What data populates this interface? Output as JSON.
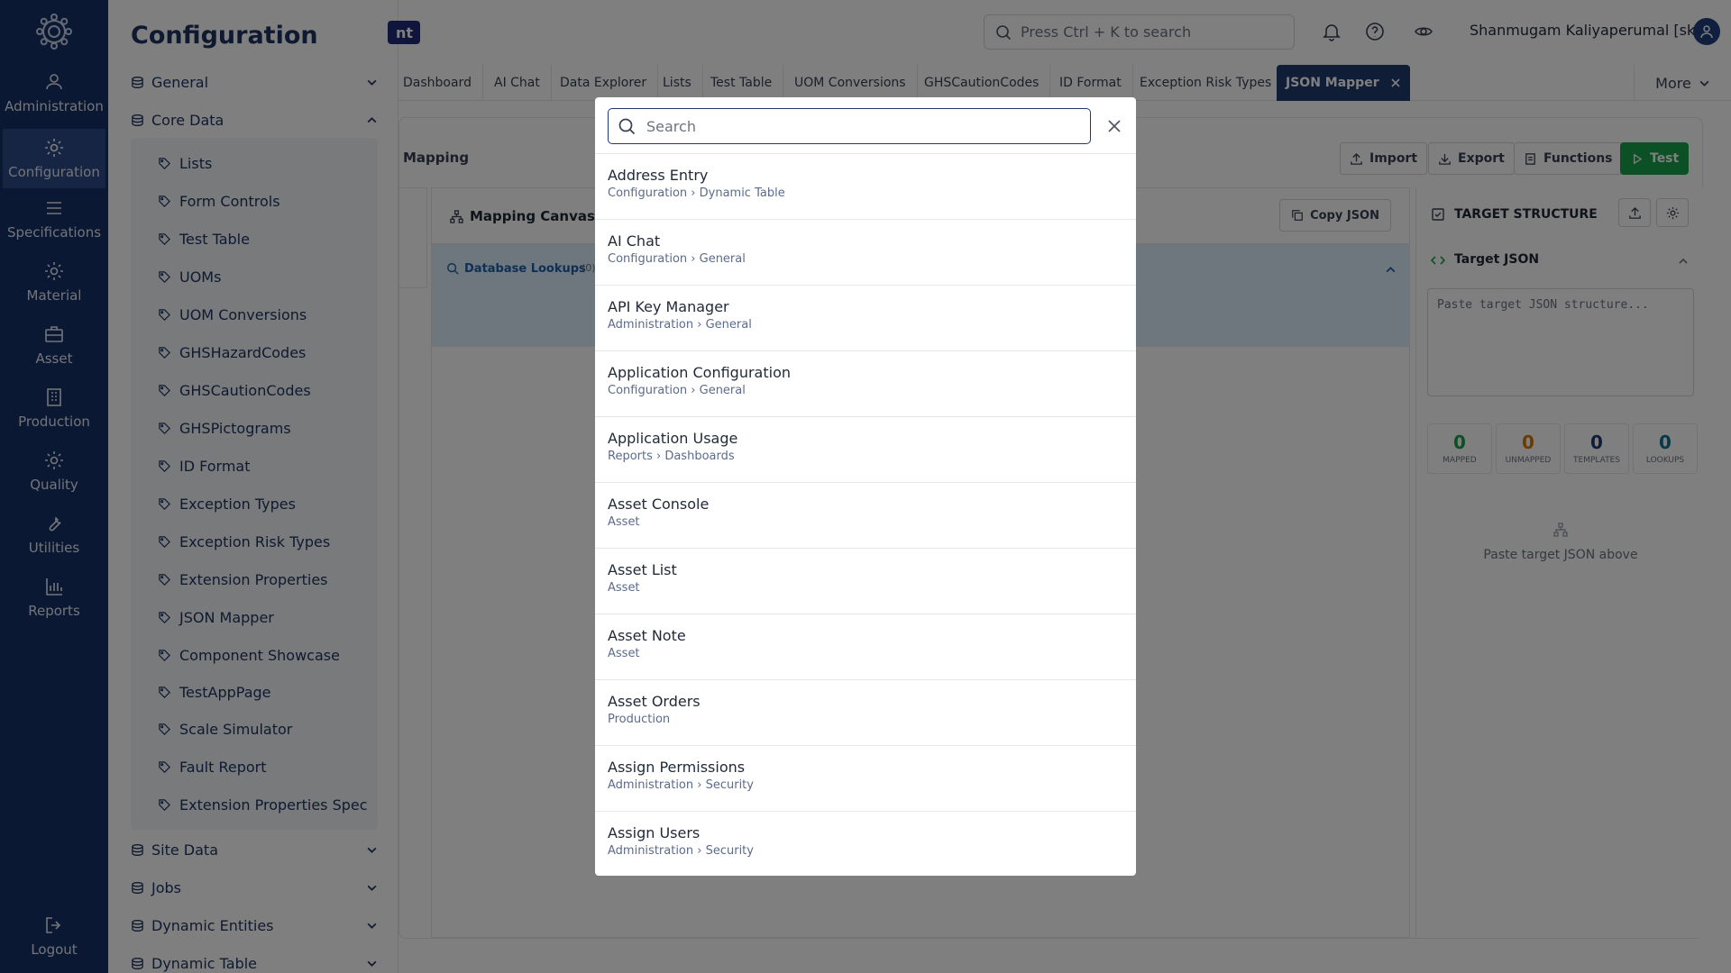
{
  "rail": {
    "items": [
      {
        "label": "Administration",
        "icon": "users-icon"
      },
      {
        "label": "Configuration",
        "icon": "gear-icon"
      },
      {
        "label": "Specifications",
        "icon": "list-icon"
      },
      {
        "label": "Material",
        "icon": "gear-icon"
      },
      {
        "label": "Asset",
        "icon": "briefcase-icon"
      },
      {
        "label": "Production",
        "icon": "building-icon"
      },
      {
        "label": "Quality",
        "icon": "gear-icon"
      },
      {
        "label": "Utilities",
        "icon": "wrench-icon"
      },
      {
        "label": "Reports",
        "icon": "bar-chart-icon"
      }
    ],
    "active": "Configuration",
    "logout": "Logout"
  },
  "sidebar": {
    "title": "Configuration",
    "groups": [
      "General",
      "Core Data",
      "Site Data",
      "Jobs",
      "Dynamic Entities",
      "Dynamic Table"
    ],
    "core_items": [
      "Lists",
      "Form Controls",
      "Test Table",
      "UOMs",
      "UOM Conversions",
      "GHSHazardCodes",
      "GHSCautionCodes",
      "GHSPictograms",
      "ID Format",
      "Exception Types",
      "Exception Risk Types",
      "Extension Properties",
      "JSON Mapper",
      "Component Showcase",
      "TestAppPage",
      "Scale Simulator",
      "Fault Report",
      "Extension Properties Spec"
    ]
  },
  "header": {
    "logo_fragment": "nt",
    "search_placeholder": "Press Ctrl + K to search",
    "user": "Shanmugam Kaliyaperumal [sk]"
  },
  "tabs": [
    "Dashboard",
    "AI Chat",
    "Data Explorer",
    "Lists",
    "Test Table",
    "UOM Conversions",
    "GHSCautionCodes",
    "ID Format",
    "Exception Risk Types"
  ],
  "active_tab": "JSON Mapper",
  "more_label": "More",
  "page": {
    "breadcrumb": "Mapping",
    "buttons": {
      "import": "Import",
      "export": "Export",
      "functions": "Functions",
      "test": "Test"
    },
    "canvas_title": "Mapping Canvas",
    "copy_json": "Copy JSON",
    "lookups_title": "Database Lookups",
    "lookups_count": "(0)",
    "target_title": "TARGET STRUCTURE",
    "target_json_title": "Target JSON",
    "target_placeholder": "Paste target JSON structure...",
    "stats": [
      {
        "value": "0",
        "label": "MAPPED",
        "color": "#16a34a"
      },
      {
        "value": "0",
        "label": "UNMAPPED",
        "color": "#d97706"
      },
      {
        "value": "0",
        "label": "TEMPLATES",
        "color": "#1e3a6e"
      },
      {
        "value": "0",
        "label": "LOOKUPS",
        "color": "#0e7490"
      }
    ],
    "target_empty": "Paste target JSON above"
  },
  "modal": {
    "placeholder": "Search",
    "results": [
      {
        "title": "Address Entry",
        "path": "Configuration › Dynamic Table"
      },
      {
        "title": "AI Chat",
        "path": "Configuration › General"
      },
      {
        "title": "API Key Manager",
        "path": "Administration › General"
      },
      {
        "title": "Application Configuration",
        "path": "Configuration › General"
      },
      {
        "title": "Application Usage",
        "path": "Reports › Dashboards"
      },
      {
        "title": "Asset Console",
        "path": "Asset"
      },
      {
        "title": "Asset List",
        "path": "Asset"
      },
      {
        "title": "Asset Note",
        "path": "Asset"
      },
      {
        "title": "Asset Orders",
        "path": "Production"
      },
      {
        "title": "Assign Permissions",
        "path": "Administration › Security"
      },
      {
        "title": "Assign Users",
        "path": "Administration › Security"
      }
    ]
  },
  "colors": {
    "rail": "#173166",
    "accent": "#1e3a6e",
    "test_button": "#16a34a"
  }
}
